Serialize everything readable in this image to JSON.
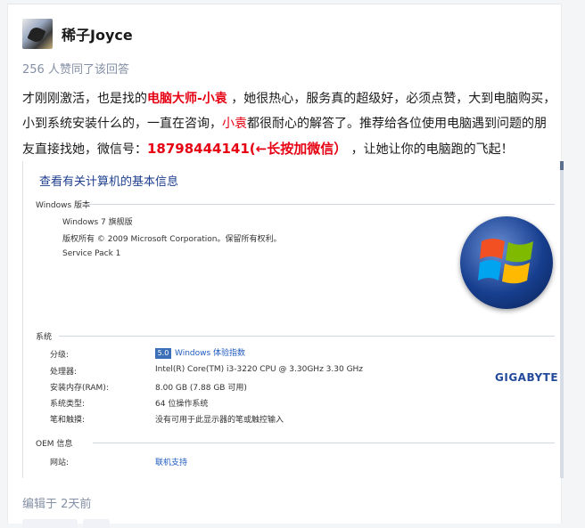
{
  "author": {
    "name": "稀子Joyce"
  },
  "likes_text": "256 人赞同了该回答",
  "answer": {
    "p1": "才刚刚激活，也是找的",
    "hl1": "电脑大师-小袁",
    "p2": " ，她很热心，服务真的超级好，必须点赞，大到电脑购买，小到系统安装什么的，一直在咨询，",
    "hl2": "小袁",
    "p3": "都很耐心的解答了。推荐给各位使用电脑遇到问题的朋友直接找她，微信号：",
    "hl3": "18798444141(←长按加微信）",
    "p4": " ，让她让你的电脑跑的飞起！"
  },
  "screenshot": {
    "title": "查看有关计算机的基本信息",
    "edition_section": "Windows 版本",
    "edition": "Windows 7 旗舰版",
    "copyright": "版权所有 © 2009 Microsoft Corporation。保留所有权利。",
    "service_pack": "Service Pack 1",
    "system_section": "系统",
    "rows": [
      {
        "label": "分级:",
        "value": "Windows 体验指数",
        "score": "5.0"
      },
      {
        "label": "处理器:",
        "value": "Intel(R) Core(TM) i3-3220 CPU @ 3.30GHz   3.30 GHz"
      },
      {
        "label": "安装内存(RAM):",
        "value": "8.00 GB (7.88 GB 可用)"
      },
      {
        "label": "系统类型:",
        "value": "64 位操作系统"
      },
      {
        "label": "笔和触摸:",
        "value": "没有可用于此显示器的笔或触控输入"
      }
    ],
    "oem_section": "OEM 信息",
    "oem_label": "网站:",
    "oem_value": "联机支持",
    "brand": "GIGABYTE"
  },
  "edited_text": "编辑于 2天前",
  "colors": {
    "highlight": "#e60012",
    "link": "#1e5bbf",
    "muted": "#8590a6"
  }
}
